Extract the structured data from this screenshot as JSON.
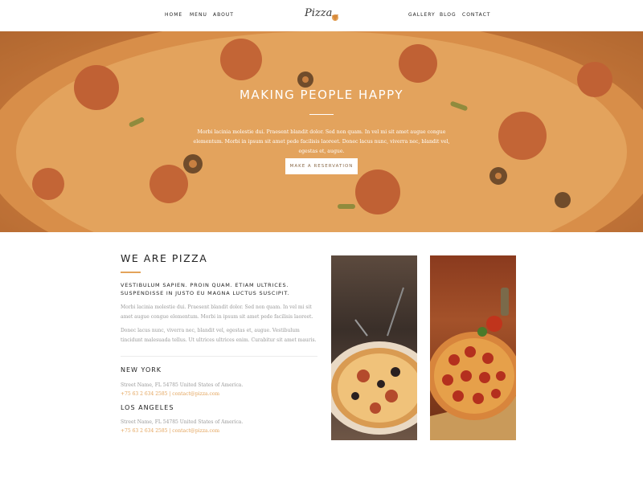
{
  "nav": {
    "left": [
      "HOME",
      "MENU",
      "ABOUT"
    ],
    "right": [
      "GALLERY",
      "BLOG",
      "CONTACT"
    ],
    "logo": "Pizza"
  },
  "hero": {
    "title": "MAKING PEOPLE HAPPY",
    "text": "Morbi lacinia molestie dui. Praesent blandit dolor. Sed non quam. In vel mi sit amet augue congue elementum. Morbi in ipsum sit amet pede facilisis laoreet. Donec lacus nunc, viverra nec, blandit vel, egestas et, augue.",
    "button": "MAKE A RESERVATION"
  },
  "about": {
    "title": "WE ARE PIZZA",
    "subtitle": "VESTIBULUM SAPIEN. PROIN QUAM. ETIAM ULTRICES. SUSPENDISSE IN JUSTO EU MAGNA LUCTUS SUSCIPIT.",
    "p1": "Morbi lacinia molestie dui. Praesent blandit dolor. Sed non quam. In vel mi sit amet augue congue elementum. Morbi in ipsum sit amet pede facilisis laoreet.",
    "p2": "Donec lacus nunc, viverra nec, blandit vel, egestas et, augue. Vestibulum tincidunt malesuada tellus. Ut ultrices ultrices enim. Curabitur sit amet mauris."
  },
  "locations": [
    {
      "city": "NEW YORK",
      "address": "Street Name, FL 54785 United States of America.",
      "contact": "+75 63 2 634 2585 | contact@pizza.com"
    },
    {
      "city": "LOS ANGELES",
      "address": "Street Name, FL 54785 United States of America.",
      "contact": "+75 63 2 634 2585 | contact@pizza.com"
    }
  ],
  "colors": {
    "accent": "#e3a35a"
  }
}
